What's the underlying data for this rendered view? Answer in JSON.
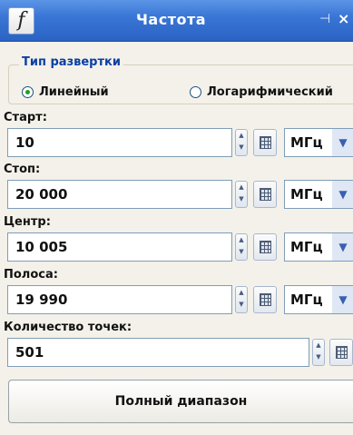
{
  "window": {
    "icon_glyph": "f",
    "title": "Частота",
    "pin_glyph": "⊣",
    "close_glyph": "×"
  },
  "sweep": {
    "legend": "Тип развертки",
    "options": [
      {
        "label": "Линейный",
        "selected": true
      },
      {
        "label": "Логарифмический",
        "selected": false
      }
    ]
  },
  "fields": [
    {
      "label": "Старт:",
      "value": "10",
      "unit": "МГц"
    },
    {
      "label": "Стоп:",
      "value": "20 000",
      "unit": "МГц"
    },
    {
      "label": "Центр:",
      "value": "10 005",
      "unit": "МГц"
    },
    {
      "label": "Полоса:",
      "value": "19 990",
      "unit": "МГц"
    }
  ],
  "points": {
    "label": "Количество точек:",
    "value": "501"
  },
  "buttons": {
    "full_range": "Полный диапазон"
  },
  "icons": {
    "spin": "spin-updown-icon",
    "calc": "calculator-icon",
    "dropdown": "chevron-down-icon"
  }
}
